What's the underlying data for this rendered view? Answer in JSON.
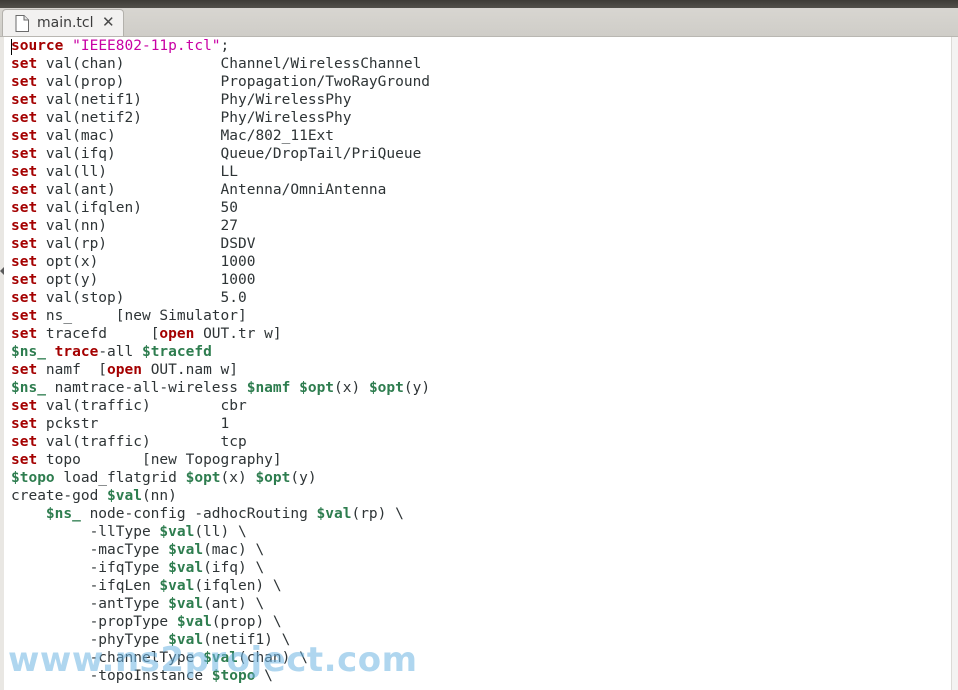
{
  "tab": {
    "filename": "main.tcl",
    "close_glyph": "✕"
  },
  "watermark": "www.ns2project.com",
  "colors": {
    "keyword": "#a40000",
    "variable": "#2e7d4f",
    "string": "#c800a4",
    "text": "#2e3436"
  },
  "code_lines": [
    [
      [
        "k",
        "source"
      ],
      [
        "t",
        " "
      ],
      [
        "s",
        "\"IEEE802-11p.tcl\""
      ],
      [
        "t",
        ";"
      ]
    ],
    [
      [
        "k",
        "set"
      ],
      [
        "t",
        " val(chan)           Channel/WirelessChannel"
      ]
    ],
    [
      [
        "k",
        "set"
      ],
      [
        "t",
        " val(prop)           Propagation/TwoRayGround"
      ]
    ],
    [
      [
        "k",
        "set"
      ],
      [
        "t",
        " val(netif1)         Phy/WirelessPhy"
      ]
    ],
    [
      [
        "k",
        "set"
      ],
      [
        "t",
        " val(netif2)         Phy/WirelessPhy"
      ]
    ],
    [
      [
        "k",
        "set"
      ],
      [
        "t",
        " val(mac)            Mac/802_11Ext"
      ]
    ],
    [
      [
        "k",
        "set"
      ],
      [
        "t",
        " val(ifq)            Queue/DropTail/PriQueue"
      ]
    ],
    [
      [
        "k",
        "set"
      ],
      [
        "t",
        " val(ll)             LL"
      ]
    ],
    [
      [
        "k",
        "set"
      ],
      [
        "t",
        " val(ant)            Antenna/OmniAntenna"
      ]
    ],
    [
      [
        "k",
        "set"
      ],
      [
        "t",
        " val(ifqlen)         50"
      ]
    ],
    [
      [
        "k",
        "set"
      ],
      [
        "t",
        " val(nn)             27"
      ]
    ],
    [
      [
        "k",
        "set"
      ],
      [
        "t",
        " val(rp)             DSDV"
      ]
    ],
    [
      [
        "k",
        "set"
      ],
      [
        "t",
        " opt(x)              1000"
      ]
    ],
    [
      [
        "k",
        "set"
      ],
      [
        "t",
        " opt(y)              1000"
      ]
    ],
    [
      [
        "k",
        "set"
      ],
      [
        "t",
        " val(stop)           5.0"
      ]
    ],
    [
      [
        "k",
        "set"
      ],
      [
        "t",
        " ns_     [new Simulator]"
      ]
    ],
    [
      [
        "k",
        "set"
      ],
      [
        "t",
        " tracefd     ["
      ],
      [
        "k",
        "open"
      ],
      [
        "t",
        " OUT.tr w]"
      ]
    ],
    [
      [
        "v",
        "$ns_"
      ],
      [
        "t",
        " "
      ],
      [
        "k",
        "trace"
      ],
      [
        "t",
        "-all "
      ],
      [
        "v",
        "$tracefd"
      ]
    ],
    [
      [
        "k",
        "set"
      ],
      [
        "t",
        " namf  ["
      ],
      [
        "k",
        "open"
      ],
      [
        "t",
        " OUT.nam w]"
      ]
    ],
    [
      [
        "v",
        "$ns_"
      ],
      [
        "t",
        " namtrace-all-wireless "
      ],
      [
        "v",
        "$namf"
      ],
      [
        "t",
        " "
      ],
      [
        "v",
        "$opt"
      ],
      [
        "t",
        "(x) "
      ],
      [
        "v",
        "$opt"
      ],
      [
        "t",
        "(y)"
      ]
    ],
    [
      [
        "k",
        "set"
      ],
      [
        "t",
        " val(traffic)        cbr"
      ]
    ],
    [
      [
        "k",
        "set"
      ],
      [
        "t",
        " pckstr              1"
      ]
    ],
    [
      [
        "k",
        "set"
      ],
      [
        "t",
        " val(traffic)        tcp"
      ]
    ],
    [
      [
        "k",
        "set"
      ],
      [
        "t",
        " topo       [new Topography]"
      ]
    ],
    [
      [
        "v",
        "$topo"
      ],
      [
        "t",
        " load_flatgrid "
      ],
      [
        "v",
        "$opt"
      ],
      [
        "t",
        "(x) "
      ],
      [
        "v",
        "$opt"
      ],
      [
        "t",
        "(y)"
      ]
    ],
    [
      [
        "t",
        "create-god "
      ],
      [
        "v",
        "$val"
      ],
      [
        "t",
        "(nn)"
      ]
    ],
    [
      [
        "t",
        "    "
      ],
      [
        "v",
        "$ns_"
      ],
      [
        "t",
        " node-config -adhocRouting "
      ],
      [
        "v",
        "$val"
      ],
      [
        "t",
        "(rp) \\"
      ]
    ],
    [
      [
        "t",
        "         -llType "
      ],
      [
        "v",
        "$val"
      ],
      [
        "t",
        "(ll) \\"
      ]
    ],
    [
      [
        "t",
        "         -macType "
      ],
      [
        "v",
        "$val"
      ],
      [
        "t",
        "(mac) \\"
      ]
    ],
    [
      [
        "t",
        "         -ifqType "
      ],
      [
        "v",
        "$val"
      ],
      [
        "t",
        "(ifq) \\"
      ]
    ],
    [
      [
        "t",
        "         -ifqLen "
      ],
      [
        "v",
        "$val"
      ],
      [
        "t",
        "(ifqlen) \\"
      ]
    ],
    [
      [
        "t",
        "         -antType "
      ],
      [
        "v",
        "$val"
      ],
      [
        "t",
        "(ant) \\"
      ]
    ],
    [
      [
        "t",
        "         -propType "
      ],
      [
        "v",
        "$val"
      ],
      [
        "t",
        "(prop) \\"
      ]
    ],
    [
      [
        "t",
        "         -phyType "
      ],
      [
        "v",
        "$val"
      ],
      [
        "t",
        "(netif1) \\"
      ]
    ],
    [
      [
        "t",
        "         -channelType "
      ],
      [
        "v",
        "$val"
      ],
      [
        "t",
        "(chan) \\"
      ]
    ],
    [
      [
        "t",
        "         -topoInstance "
      ],
      [
        "v",
        "$topo"
      ],
      [
        "t",
        " \\"
      ]
    ]
  ]
}
